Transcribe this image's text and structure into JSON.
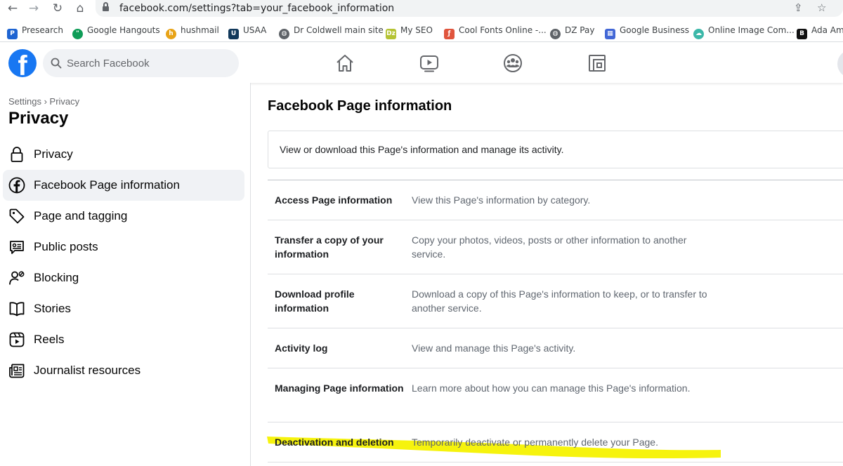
{
  "browser": {
    "url": "facebook.com/settings?tab=your_facebook_information",
    "bookmarks": [
      {
        "label": "Presearch",
        "icon": "presearch-icon",
        "color": "#1e64d2"
      },
      {
        "label": "Google Hangouts",
        "icon": "hangouts-icon",
        "color": "#0f9d58"
      },
      {
        "label": "hushmail",
        "icon": "hushmail-icon",
        "color": "#e8a317"
      },
      {
        "label": "USAA",
        "icon": "usaa-icon",
        "color": "#12395b"
      },
      {
        "label": "Dr Coldwell main site",
        "icon": "globe-icon",
        "color": "#5f6368"
      },
      {
        "label": "My SEO",
        "icon": "dz-icon",
        "color": "#b5c334"
      },
      {
        "label": "Cool Fonts Online -...",
        "icon": "coolfonts-icon",
        "color": "#e0553d"
      },
      {
        "label": "DZ Pay",
        "icon": "globe-icon",
        "color": "#5f6368"
      },
      {
        "label": "Google Business",
        "icon": "google-business-icon",
        "color": "#4267d6"
      },
      {
        "label": "Online Image Com...",
        "icon": "image-compressor-icon",
        "color": "#3cb8a9"
      },
      {
        "label": "Ada Am",
        "icon": "big-icon",
        "color": "#111111"
      }
    ]
  },
  "header": {
    "logo": "f",
    "search_placeholder": "Search Facebook",
    "brand_color": "#1877f2"
  },
  "sidebar": {
    "breadcrumb": "Settings › Privacy",
    "title": "Privacy",
    "items": [
      {
        "label": "Privacy",
        "icon": "lock-icon"
      },
      {
        "label": "Facebook Page information",
        "icon": "facebook-icon",
        "active": true
      },
      {
        "label": "Page and tagging",
        "icon": "tag-icon"
      },
      {
        "label": "Public posts",
        "icon": "public-posts-icon"
      },
      {
        "label": "Blocking",
        "icon": "blocking-icon"
      },
      {
        "label": "Stories",
        "icon": "book-icon"
      },
      {
        "label": "Reels",
        "icon": "reels-icon"
      },
      {
        "label": "Journalist resources",
        "icon": "newspaper-icon"
      }
    ]
  },
  "main": {
    "title": "Facebook Page information",
    "intro": "View or download this Page's information and manage its activity.",
    "rows": [
      {
        "label": "Access Page information",
        "desc": "View this Page's information by category."
      },
      {
        "label": "Transfer a copy of your information",
        "desc": "Copy your photos, videos, posts or other information to another service."
      },
      {
        "label": "Download profile information",
        "desc": "Download a copy of this Page's information to keep, or to transfer to another service."
      },
      {
        "label": "Activity log",
        "desc": "View and manage this Page's activity."
      },
      {
        "label": "Managing Page information",
        "desc": "Learn more about how you can manage this Page's information."
      },
      {
        "label": "Deactivation and deletion",
        "desc": "Temporarily deactivate or permanently delete your Page.",
        "highlighted": true
      }
    ],
    "highlight_color": "#f5f200"
  }
}
